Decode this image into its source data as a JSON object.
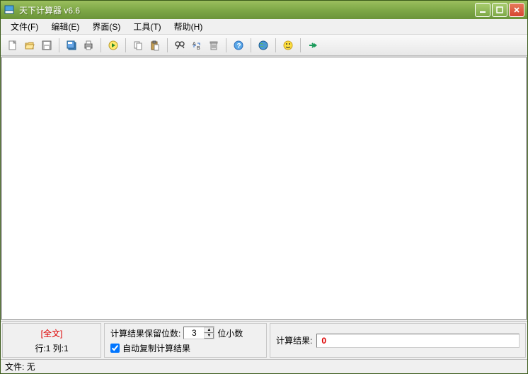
{
  "title": "天下计算器 v6.6",
  "menu": {
    "file": "文件(F)",
    "edit": "编辑(E)",
    "view": "界面(S)",
    "tools": "工具(T)",
    "help": "帮助(H)"
  },
  "bottom": {
    "fulltext": "[全文]",
    "position": "行:1 列:1",
    "decimal_label": "计算结果保留位数:",
    "decimal_value": "3",
    "decimal_suffix": "位小数",
    "autocopy_label": "自动复制计算结果",
    "autocopy_checked": true,
    "result_label": "计算结果:",
    "result_value": "0"
  },
  "status": {
    "file": "文件: 无"
  }
}
